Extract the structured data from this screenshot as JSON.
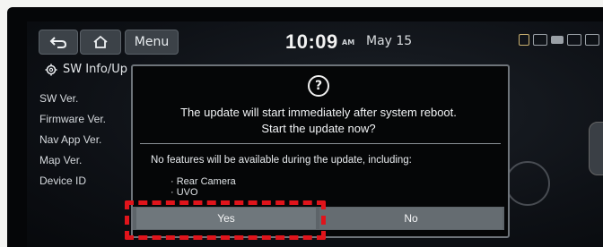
{
  "header": {
    "menu_label": "Menu",
    "time": "10:09",
    "ampm": "AM",
    "date": "May 15"
  },
  "icons": {
    "back": "back-arrow-icon",
    "home": "home-icon",
    "settings": "gear-icon",
    "info": "question-circle-icon"
  },
  "sidebar": {
    "title": "SW Info/Up",
    "items": [
      {
        "label": "SW Ver."
      },
      {
        "label": "Firmware Ver."
      },
      {
        "label": "Nav App Ver."
      },
      {
        "label": "Map Ver."
      },
      {
        "label": "Device ID"
      }
    ]
  },
  "dialog": {
    "line1": "The update will start immediately after system reboot.",
    "line2": "Start the update now?",
    "info": "No features will be available during the update, including:",
    "features": [
      "· Rear Camera",
      "· UVO"
    ],
    "yes_label": "Yes",
    "no_label": "No"
  },
  "colors": {
    "highlight": "#e0141b",
    "dialog_bg": "#050607",
    "button_bg": "#6f777c"
  }
}
